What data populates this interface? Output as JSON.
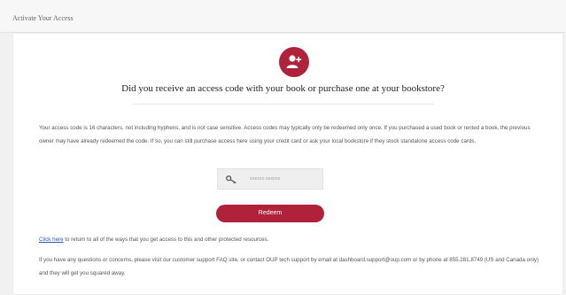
{
  "header": {
    "title": "Activate Your Access"
  },
  "main": {
    "icon": "add-user-icon",
    "question": "Did you receive an access code with your book or purchase one at your bookstore?",
    "description": "Your access code is 16 characters, not including hyphens, and is not case sensitive. Access codes may typically only be redeemed only once. If you purchased a used book or rented a book, the previous owner may have already redeemed the code. If so, you can still purchase access here using your credit card or ask your local bookstore if they stock standalone access code cards.",
    "code_input": {
      "placeholder": "xxxxxx-xxxxxx",
      "icon": "key-icon"
    },
    "redeem_label": "Redeem",
    "return_link": "Click here",
    "return_text": " to return to all of the ways that you get access to this and other protected resources.",
    "support_text": "If you have any questions or concerns, please visit our customer support FAQ site, or contact OUP tech support by email at dashboard.support@oup.com or by phone at 855.281.8749 (US and Canada only) and they will get you squared away."
  },
  "colors": {
    "accent": "#b0213a",
    "link": "#2b57b9",
    "background": "#f1f1f1",
    "card": "#ffffff"
  }
}
